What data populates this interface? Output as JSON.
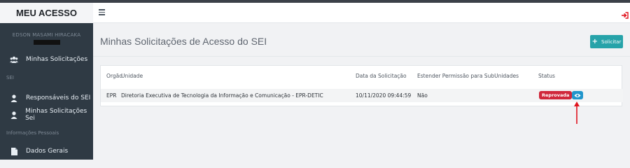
{
  "app": {
    "brand": "MEU ACESSO"
  },
  "sidebar": {
    "user_name": "EDSON MASAMI HIRACAKA",
    "items": [
      {
        "label": "Minhas Solicitações",
        "icon": "users-icon"
      },
      {
        "section": "SEI"
      },
      {
        "label": "Responsáveis do SEI",
        "icon": "user-icon"
      },
      {
        "label": "Minhas Solicitações Sei",
        "icon": "user-icon"
      },
      {
        "section": "Informações Pessoais"
      },
      {
        "label": "Dados Gerais",
        "icon": "file-icon"
      }
    ]
  },
  "header": {
    "menu_icon": "hamburger-icon",
    "logout_icon": "sign-out-icon"
  },
  "main": {
    "title": "Minhas Solicitações de Acesso do SEI",
    "solicitar_label": "Solicitar"
  },
  "table": {
    "columns": [
      "Orgão",
      "Unidade",
      "Data da Solicitação",
      "Estender Permissão para SubUnidades",
      "Status"
    ],
    "rows": [
      {
        "orgao": "EPR",
        "unidade": "Diretoria Executiva de Tecnologia da Informação e Comunicação - EPR-DETIC",
        "data": "10/11/2020 09:44:59",
        "estender": "Não",
        "status": "Reprovada"
      }
    ]
  },
  "colors": {
    "sidebar": "#2f3a44",
    "accent": "#26a3a9",
    "status_reprovada": "#d0283b",
    "eye_button": "#2196cc",
    "annotation_arrow": "#e0141e"
  }
}
